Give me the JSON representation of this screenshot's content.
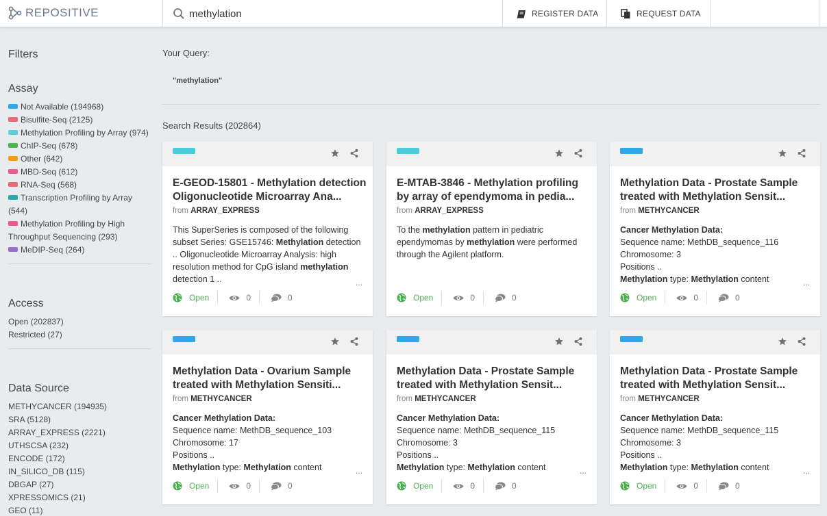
{
  "header": {
    "logo": "REPOSITIVE",
    "search_value": "methylation",
    "register_label": "REGISTER DATA",
    "request_label": "REQUEST DATA"
  },
  "sidebar": {
    "filters_title": "Filters",
    "assay": {
      "title": "Assay",
      "items": [
        {
          "label": "Not Available (194968)",
          "color": "#35a7e6"
        },
        {
          "label": "Bisulfite-Seq (2125)",
          "color": "#e86b7a"
        },
        {
          "label": "Methylation Profiling by Array (974)",
          "color": "#5ccfd9"
        },
        {
          "label": "ChIP-Seq (678)",
          "color": "#4cb84c"
        },
        {
          "label": "Other (642)",
          "color": "#f39c12"
        },
        {
          "label": "MBD-Seq (612)",
          "color": "#e85d8e"
        },
        {
          "label": "RNA-Seq (568)",
          "color": "#e86b7a"
        },
        {
          "label": "Transcription Profiling by Array",
          "label2": "(544)",
          "color": "#2aa9a9"
        },
        {
          "label": "Methylation Profiling by High",
          "label2": "Throughput Sequencing (293)",
          "color": "#e85d8e"
        },
        {
          "label": "MeDIP-Seq (264)",
          "color": "#9b6cc8"
        }
      ]
    },
    "access": {
      "title": "Access",
      "items": [
        "Open (202837)",
        "Restricted (27)"
      ]
    },
    "data_source": {
      "title": "Data Source",
      "items": [
        "METHYCANCER (194935)",
        "SRA (5128)",
        "ARRAY_EXPRESS (2221)",
        "UTHSCSA (232)",
        "ENCODE (172)",
        "IN_SILICO_DB (115)",
        "DBGAP (27)",
        "XPRESSOMICS (21)",
        "GEO (11)"
      ]
    }
  },
  "main": {
    "query_label": "Your Query:",
    "query_value": "\"methylation\"",
    "results_label": "Search Results (202864)"
  },
  "cards": [
    {
      "tag_color": "#4dcbd9",
      "title": "E-GEOD-15801 - Methylation detection Oligonucleotide Microarray Ana...",
      "from_prefix": "from",
      "source": "ARRAY_EXPRESS",
      "desc_html": "This SuperSeries is composed of the following subset Series: GSE15746: <b>Methylation</b> detection .. Oligonucleotide Microarray Analysis: high resolution method for CpG island <b>methylation</b> detection 1 ..",
      "ellipsis": "...",
      "access": "Open",
      "views": "0",
      "comments": "0"
    },
    {
      "tag_color": "#4dcbd9",
      "title": "E-MTAB-3846 - Methylation profiling by array of ependymoma in pedia...",
      "from_prefix": "from",
      "source": "ARRAY_EXPRESS",
      "desc_html": "To the <b>methylation</b> pattern in pediatric ependymomas by <b>methylation</b> were performed through the Agilent platform.",
      "ellipsis": "",
      "access": "Open",
      "views": "0",
      "comments": "0"
    },
    {
      "tag_color": "#2ea8e6",
      "title": "Methylation Data - Prostate Sample treated with Methylation Sensit...",
      "from_prefix": "from",
      "source": "METHYCANCER",
      "desc_html": "<b>Cancer Methylation Data:</b><br>Sequence name: MethDB_sequence_116<br>Chromosome: 3<br>Positions ..<br><b>Methylation</b> type: <b>Methylation</b> content",
      "ellipsis": "...",
      "access": "Open",
      "views": "0",
      "comments": "0"
    },
    {
      "tag_color": "#2ea8e6",
      "title": "Methylation Data - Ovarium Sample treated with Methylation Sensiti...",
      "from_prefix": "from",
      "source": "METHYCANCER",
      "desc_html": "<b>Cancer Methylation Data:</b><br>Sequence name: MethDB_sequence_103<br>Chromosome: 17<br>Positions ..<br><b>Methylation</b> type: <b>Methylation</b> content",
      "ellipsis": "...",
      "access": "Open",
      "views": "0",
      "comments": "0"
    },
    {
      "tag_color": "#2ea8e6",
      "title": "Methylation Data - Prostate Sample treated with Methylation Sensit...",
      "from_prefix": "from",
      "source": "METHYCANCER",
      "desc_html": "<b>Cancer Methylation Data:</b><br>Sequence name: MethDB_sequence_115<br>Chromosome: 3<br>Positions ..<br><b>Methylation</b> type: <b>Methylation</b> content",
      "ellipsis": "...",
      "access": "Open",
      "views": "0",
      "comments": "0"
    },
    {
      "tag_color": "#2ea8e6",
      "title": "Methylation Data - Prostate Sample treated with Methylation Sensit...",
      "from_prefix": "from",
      "source": "METHYCANCER",
      "desc_html": "<b>Cancer Methylation Data:</b><br>Sequence name: MethDB_sequence_115<br>Chromosome: 3<br>Positions ..<br><b>Methylation</b> type: <b>Methylation</b> content",
      "ellipsis": "...",
      "access": "Open",
      "views": "0",
      "comments": "0"
    }
  ]
}
